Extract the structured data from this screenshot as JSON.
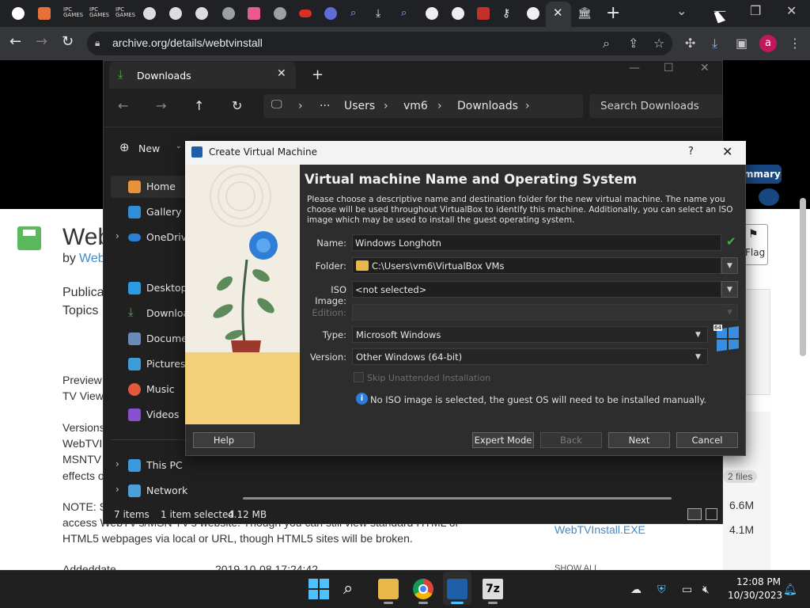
{
  "browser": {
    "url": "archive.org/details/webtvinstall",
    "profile_initial": "a",
    "tab_labels": [
      "IPC\nGAMES",
      "IPC\nGAMES",
      "IPC\nGAMES"
    ]
  },
  "webpage": {
    "title_fragment": "Web",
    "by_label": "by",
    "by_link": "Web",
    "publication_fragment": "Publica",
    "topics_fragment": "Topics",
    "preview_line1": "Preview",
    "preview_line2": "TV View",
    "versions_lines": [
      "Versions",
      "WebTVI",
      "MSNTV",
      "effects o"
    ],
    "note_line1": "NOTE: S",
    "note_line2": "access WebTV's/MSN TV's website. Though you can still view standard HTML or",
    "note_line3": "HTML5 webpages via local or URL, though HTML5 sites will be broken.",
    "addeddate_label": "Addeddate",
    "addeddate_value": "2019-10-08 17:24:42",
    "summary_btn": "mmary",
    "flag_label": "Flag",
    "files_count": "2 files",
    "file_size_1": "6.6M",
    "file_link_2": "WebTVInstall.EXE",
    "file_size_2": "4.1M",
    "show_all": "SHOW ALL"
  },
  "explorer": {
    "tab_title": "Downloads",
    "breadcrumb": [
      "Users",
      "vm6",
      "Downloads"
    ],
    "ellipsis": "···",
    "search_placeholder": "Search Downloads",
    "new_label": "New",
    "sidebar": [
      {
        "label": "Home",
        "icon": "home-icon"
      },
      {
        "label": "Gallery",
        "icon": "gallery-icon"
      },
      {
        "label": "OneDrive",
        "icon": "onedrive-icon"
      },
      {
        "label": "Desktop",
        "icon": "desktop-icon"
      },
      {
        "label": "Downloads",
        "icon": "downloads-icon"
      },
      {
        "label": "Documents",
        "icon": "documents-icon"
      },
      {
        "label": "Pictures",
        "icon": "pictures-icon"
      },
      {
        "label": "Music",
        "icon": "music-icon"
      },
      {
        "label": "Videos",
        "icon": "videos-icon"
      },
      {
        "label": "This PC",
        "icon": "this-pc-icon"
      },
      {
        "label": "Network",
        "icon": "network-icon"
      }
    ],
    "status_items": "7 items",
    "status_selected": "1 item selected",
    "status_size": "4.12 MB"
  },
  "vbox": {
    "window_title": "Create Virtual Machine",
    "help_q": "?",
    "heading": "Virtual machine Name and Operating System",
    "description": "Please choose a descriptive name and destination folder for the new virtual machine. The name you choose will be used throughout VirtualBox to identify this machine. Additionally, you can select an ISO image which may be used to install the guest operating system.",
    "fields": {
      "name_label": "Name:",
      "name_value": "Windows Longhotn",
      "folder_label": "Folder:",
      "folder_value": "C:\\Users\\vm6\\VirtualBox VMs",
      "iso_label": "ISO Image:",
      "iso_value": "<not selected>",
      "edition_label": "Edition:",
      "edition_value": "",
      "type_label": "Type:",
      "type_value": "Microsoft Windows",
      "version_label": "Version:",
      "version_value": "Other Windows (64-bit)",
      "os_badge": "64"
    },
    "skip_unattended_label": "Skip Unattended Installation",
    "info_message": "No ISO image is selected, the guest OS will need to be installed manually.",
    "buttons": {
      "help": "Help",
      "expert": "Expert Mode",
      "back": "Back",
      "next": "Next",
      "cancel": "Cancel"
    }
  },
  "taskbar": {
    "time": "12:08 PM",
    "date": "10/30/2023",
    "seven_zip_label": "7z"
  },
  "colors": {
    "accent_vbox_blue": "#2b6cc4",
    "chrome_dark": "#202124",
    "valid_check_green": "#3fb33f"
  }
}
